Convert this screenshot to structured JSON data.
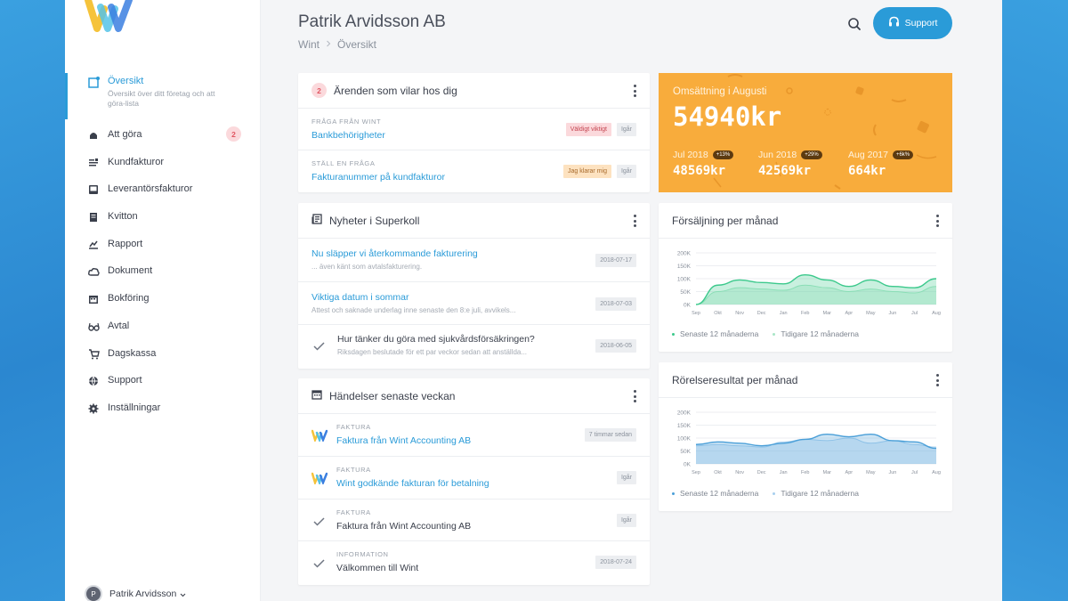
{
  "header": {
    "title": "Patrik Arvidsson AB",
    "breadcrumb": [
      "Wint",
      "Översikt"
    ],
    "support_label": "Support"
  },
  "sidebar": {
    "items": [
      {
        "label": "Översikt",
        "sub": "Översikt över ditt företag och att göra-lista",
        "icon": "overview-icon",
        "active": true
      },
      {
        "label": "Att göra",
        "icon": "todo-icon",
        "badge": "2"
      },
      {
        "label": "Kundfakturor",
        "icon": "invoice-icon"
      },
      {
        "label": "Leverantörsfakturor",
        "icon": "inbox-icon"
      },
      {
        "label": "Kvitton",
        "icon": "receipt-icon"
      },
      {
        "label": "Rapport",
        "icon": "report-icon"
      },
      {
        "label": "Dokument",
        "icon": "cloud-icon"
      },
      {
        "label": "Bokföring",
        "icon": "calendar-icon"
      },
      {
        "label": "Avtal",
        "icon": "glasses-icon"
      },
      {
        "label": "Dagskassa",
        "icon": "cart-icon"
      },
      {
        "label": "Support",
        "icon": "globe-icon"
      },
      {
        "label": "Inställningar",
        "icon": "gear-icon"
      }
    ],
    "user": {
      "initial": "P",
      "name": "Patrik Arvidsson"
    }
  },
  "tasks": {
    "count": "2",
    "title": "Ärenden som vilar hos dig",
    "items": [
      {
        "kicker": "Fråga från Wint",
        "title": "Bankbehörigheter",
        "tags": [
          "Väldigt viktigt",
          "Igår"
        ]
      },
      {
        "kicker": "Ställ en fråga",
        "title": "Fakturanummer på kundfakturor",
        "tags": [
          "Jag klarar mig",
          "Igår"
        ]
      }
    ]
  },
  "news": {
    "title": "Nyheter i Superkoll",
    "items": [
      {
        "title": "Nu släpper vi återkommande fakturering",
        "desc": "... även känt som avtalsfakturering.",
        "date": "2018-07-17"
      },
      {
        "title": "Viktiga datum i sommar",
        "desc": "Attest och saknade underlag inne senaste den 8:e juli, avvikels...",
        "date": "2018-07-03"
      },
      {
        "title": "Hur tänker du göra med sjukvårdsförsäkringen?",
        "desc": "Riksdagen beslutade för ett par veckor sedan att anställda...",
        "date": "2018-06-05"
      }
    ]
  },
  "events": {
    "title": "Händelser senaste veckan",
    "items": [
      {
        "kicker": "Faktura",
        "title": "Faktura från Wint Accounting AB",
        "time": "7 timmar sedan",
        "icon": "wint-logo-icon"
      },
      {
        "kicker": "Faktura",
        "title": "Wint godkände fakturan för betalning",
        "time": "Igår",
        "icon": "wint-logo-icon"
      },
      {
        "kicker": "Faktura",
        "title": "Faktura från Wint Accounting AB",
        "time": "Igår",
        "icon": "check-icon"
      },
      {
        "kicker": "Information",
        "title": "Välkommen till Wint",
        "time": "2018-07-24",
        "icon": "check-icon"
      }
    ]
  },
  "revenue": {
    "label": "Omsättning i Augusti",
    "value": "54940kr",
    "stats": [
      {
        "month": "Jul 2018",
        "pct": "+13%",
        "value": "48569kr"
      },
      {
        "month": "Jun 2018",
        "pct": "+29%",
        "value": "42569kr"
      },
      {
        "month": "Aug 2017",
        "pct": "+6k%",
        "value": "664kr"
      }
    ]
  },
  "sales_chart": {
    "title": "Försäljning per månad",
    "legend": [
      "Senaste 12 månaderna",
      "Tidigare 12 månaderna"
    ],
    "colors": [
      "#3cc98c",
      "#a8e6c6"
    ]
  },
  "result_chart": {
    "title": "Rörelseresultat per månad",
    "legend": [
      "Senaste 12 månaderna",
      "Tidigare 12 månaderna"
    ],
    "colors": [
      "#4a9fd8",
      "#a7cfee"
    ]
  },
  "chart_data": [
    {
      "type": "area",
      "title": "Försäljning per månad",
      "categories": [
        "Sep",
        "Okt",
        "Nov",
        "Dec",
        "Jan",
        "Feb",
        "Mar",
        "Apr",
        "May",
        "Jun",
        "Jul",
        "Aug"
      ],
      "yticks": [
        "200K",
        "150K",
        "100K",
        "50K",
        "0K"
      ],
      "ylim": [
        0,
        200000
      ],
      "series": [
        {
          "name": "Senaste 12 månaderna",
          "values": [
            0,
            75000,
            95000,
            85000,
            80000,
            115000,
            95000,
            70000,
            95000,
            70000,
            65000,
            100000
          ]
        },
        {
          "name": "Tidigare 12 månaderna",
          "values": [
            0,
            50000,
            65000,
            60000,
            55000,
            75000,
            65000,
            50000,
            60000,
            50000,
            45000,
            70000
          ]
        }
      ]
    },
    {
      "type": "area",
      "title": "Rörelseresultat per månad",
      "categories": [
        "Sep",
        "Okt",
        "Nov",
        "Dec",
        "Jan",
        "Feb",
        "Mar",
        "Apr",
        "May",
        "Jun",
        "Jul",
        "Aug"
      ],
      "yticks": [
        "200K",
        "150K",
        "100K",
        "50K",
        "0K"
      ],
      "ylim": [
        0,
        200000
      ],
      "series": [
        {
          "name": "Senaste 12 månaderna",
          "values": [
            75000,
            85000,
            80000,
            70000,
            80000,
            95000,
            115000,
            105000,
            115000,
            90000,
            85000,
            60000
          ]
        },
        {
          "name": "Tidigare 12 månaderna",
          "values": [
            70000,
            75000,
            70000,
            65000,
            85000,
            95000,
            90000,
            100000,
            80000,
            90000,
            75000,
            65000
          ]
        }
      ]
    }
  ]
}
